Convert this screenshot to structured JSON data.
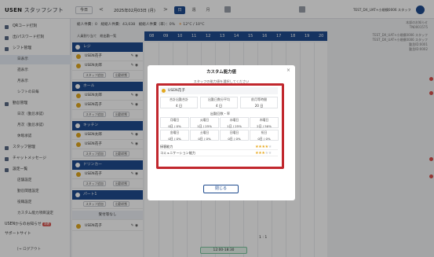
{
  "app": {
    "logo_prefix": "USEN",
    "logo_suffix": "スタッフシフト"
  },
  "toolbar": {
    "today": "今日",
    "prev": "<",
    "next": ">",
    "date": "2025年02月03日 (月)",
    "view_day": "日",
    "view_week": "週",
    "view_month": "月"
  },
  "user": {
    "name": "TEST_DX_UAT+小規模0006 スタッフ"
  },
  "sidebar": {
    "items": [
      {
        "label": "QRコード打刻"
      },
      {
        "label": "出/パスワード打刻"
      },
      {
        "label": "シフト管理"
      },
      {
        "label": "日表示"
      },
      {
        "label": "週表示"
      },
      {
        "label": "月表示"
      },
      {
        "label": "シフトの日毎"
      },
      {
        "label": "勤怠管理"
      },
      {
        "label": "日次（勤怠承認）"
      },
      {
        "label": "月次（勤怠承認）"
      },
      {
        "label": "休暇承認"
      },
      {
        "label": "スタッフ管理"
      },
      {
        "label": "チャットメッセージ"
      },
      {
        "label": "設定一覧"
      },
      {
        "label": "店舗設定"
      },
      {
        "label": "勤怠関連設定"
      },
      {
        "label": "役職設定"
      },
      {
        "label": "カスタム能力項目設定"
      },
      {
        "label": "USENからのお知らせ"
      },
      {
        "label": "サポートサイト"
      }
    ],
    "news_badge": "新着",
    "logout": "ログアウト"
  },
  "main": {
    "summary": "総人件費：0　総総人件費：43,038　総総人件費（率）：0%",
    "temp": "12°C / 10°C",
    "add_staff": "人員割り当て",
    "sort": "総出勤一覧",
    "hours": [
      "08",
      "09",
      "10",
      "11",
      "12",
      "13",
      "14",
      "15",
      "16",
      "17",
      "18",
      "19",
      "20"
    ],
    "group_labels": [
      "レジ",
      "ホール",
      "キッチン",
      "ドリンカー",
      "パート1",
      "受付等なし"
    ],
    "staff_rows": [
      "USEN花子",
      "USEN太郎",
      "スタッフ追加",
      "USEN太郎",
      "USEN花子",
      "USEN太郎",
      "USEN花子",
      "USEN花子",
      "USEN花子",
      "USEN花子"
    ],
    "chip_add": "スタッフ追加",
    "chip_edit": "出勤状態",
    "ratio": "1 : 1",
    "shift_time": "12:00-18:30",
    "right_info": [
      "本部のお知らせ",
      "TN0001575",
      "TEST_DX_UAT+小規模0006 スタッフ",
      "TEST_DX_UAT+小規模0006 スタッフ",
      "勤怠ID:0001",
      "勤怠ID:0002"
    ]
  },
  "modal": {
    "title": "カスタム能力値",
    "description": "スタッフの能力値を選択してください",
    "staff_name": "USEN花子",
    "stats": [
      {
        "label": "合計出勤合計",
        "value": "4 日"
      },
      {
        "label": "出勤日数分平均",
        "value": "4 日"
      },
      {
        "label": "前月等時間",
        "value": "20 日"
      }
    ],
    "section_title": "出勤回数・率",
    "days_row1": [
      {
        "day": "月曜日",
        "value": "0日 / 0%"
      },
      {
        "day": "火曜日",
        "value": "1日 / 25%"
      },
      {
        "day": "水曜日",
        "value": "1日 / 25%"
      },
      {
        "day": "木曜日",
        "value": "2日 / 50%"
      }
    ],
    "days_row2": [
      {
        "day": "金曜日",
        "value": "0日 / 0%"
      },
      {
        "day": "土曜日",
        "value": "0日 / 0%"
      },
      {
        "day": "日曜日",
        "value": "0日 / 0%"
      },
      {
        "day": "祝日",
        "value": "0日 / 0%"
      }
    ],
    "evaluations": [
      {
        "label": "接客能力",
        "stars": 4
      },
      {
        "label": "コミュニケーション能力",
        "stars": 3
      }
    ],
    "close_label": "閉じる",
    "close_icon": "×"
  },
  "colors": {
    "accent": "#1f4c8f",
    "highlight": "#c1272d",
    "star": "#e8a81c"
  }
}
